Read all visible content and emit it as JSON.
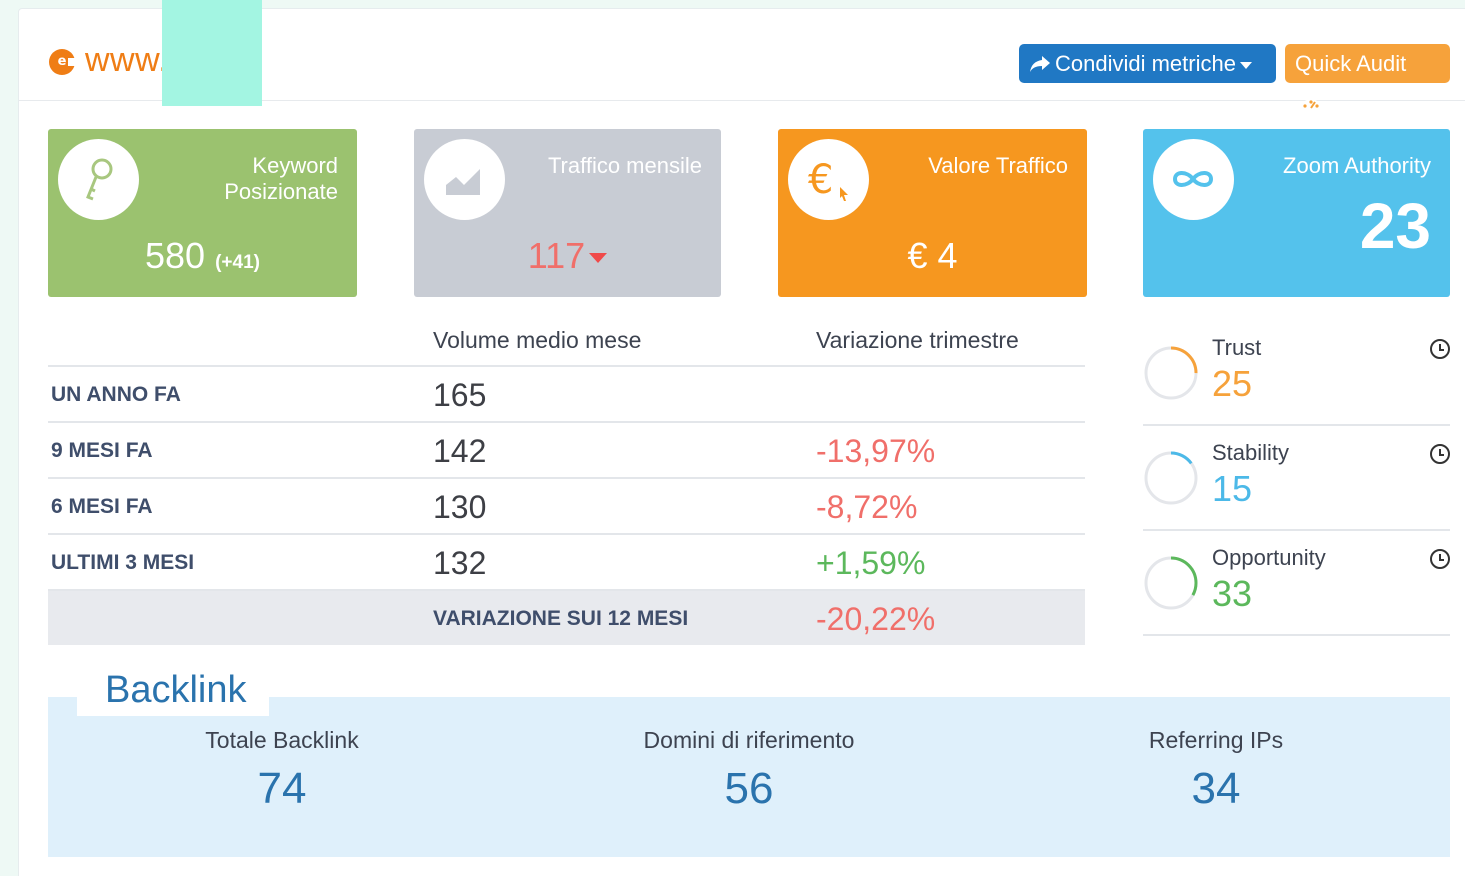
{
  "header": {
    "logo_letter": "e",
    "domain": "www.        i.it",
    "share_button": "Condividi metriche",
    "audit_button": "Quick Audit"
  },
  "tiles": {
    "keyword": {
      "title_line1": "Keyword",
      "title_line2": "Posizionate",
      "value": "580",
      "delta": "(+41)"
    },
    "traffic": {
      "title": "Traffico mensile",
      "value": "117"
    },
    "value": {
      "title": "Valore Traffico",
      "value": "€ 4"
    },
    "zoom": {
      "title": "Zoom Authority",
      "value": "23"
    }
  },
  "table": {
    "headers": {
      "volume": "Volume medio mese",
      "variation": "Variazione trimestre"
    },
    "rows": [
      {
        "label": "UN ANNO FA",
        "volume": "165",
        "variation": ""
      },
      {
        "label": "9 MESI FA",
        "volume": "142",
        "variation": "-13,97%"
      },
      {
        "label": "6 MESI FA",
        "volume": "130",
        "variation": "-8,72%"
      },
      {
        "label": "ULTIMI 3 MESI",
        "volume": "132",
        "variation": "+1,59%"
      }
    ],
    "total": {
      "label": "VARIAZIONE SUI 12 MESI",
      "value": "-20,22%"
    }
  },
  "metrics": [
    {
      "label": "Trust",
      "value": "25",
      "color": "#f6a23b",
      "level": 0.25
    },
    {
      "label": "Stability",
      "value": "15",
      "color": "#4cb9e8",
      "level": 0.15
    },
    {
      "label": "Opportunity",
      "value": "33",
      "color": "#5cb85c",
      "level": 0.33
    }
  ],
  "backlink": {
    "title": "Backlink",
    "items": [
      {
        "label": "Totale Backlink",
        "value": "74"
      },
      {
        "label": "Domini di riferimento",
        "value": "56"
      },
      {
        "label": "Referring IPs",
        "value": "34"
      }
    ]
  },
  "colors": {
    "orange": "#ef7d15",
    "green": "#9bc26f",
    "grey": "#c8ccd4",
    "amber": "#f6971f",
    "sky": "#54c2ec",
    "blue": "#2a73ad"
  }
}
